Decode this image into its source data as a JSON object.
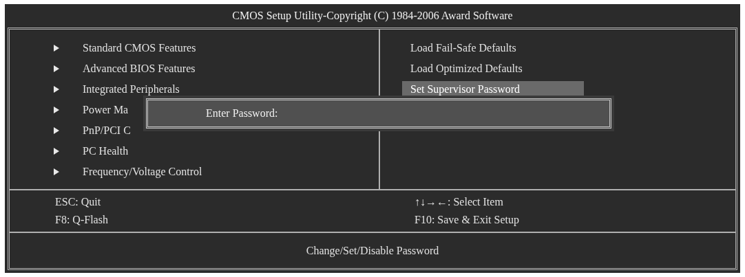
{
  "title": "CMOS Setup Utility-Copyright (C) 1984-2006 Award Software",
  "left_menu": [
    {
      "label": "Standard CMOS Features"
    },
    {
      "label": "Advanced BIOS Features"
    },
    {
      "label": "Integrated Peripherals"
    },
    {
      "label": "Power Ma"
    },
    {
      "label": "PnP/PCI C"
    },
    {
      "label": "PC Health"
    },
    {
      "label": "Frequency/Voltage Control"
    }
  ],
  "right_menu": [
    {
      "label": "Load Fail-Safe Defaults",
      "selected": false
    },
    {
      "label": "Load Optimized Defaults",
      "selected": false
    },
    {
      "label": "Set Supervisor Password",
      "selected": true
    }
  ],
  "password_dialog": {
    "label": "Enter Password:"
  },
  "key_help": {
    "left": [
      "ESC: Quit",
      "F8: Q-Flash"
    ],
    "right": [
      "↑↓→←: Select Item",
      "F10: Save & Exit Setup"
    ]
  },
  "status_bar": "Change/Set/Disable Password"
}
